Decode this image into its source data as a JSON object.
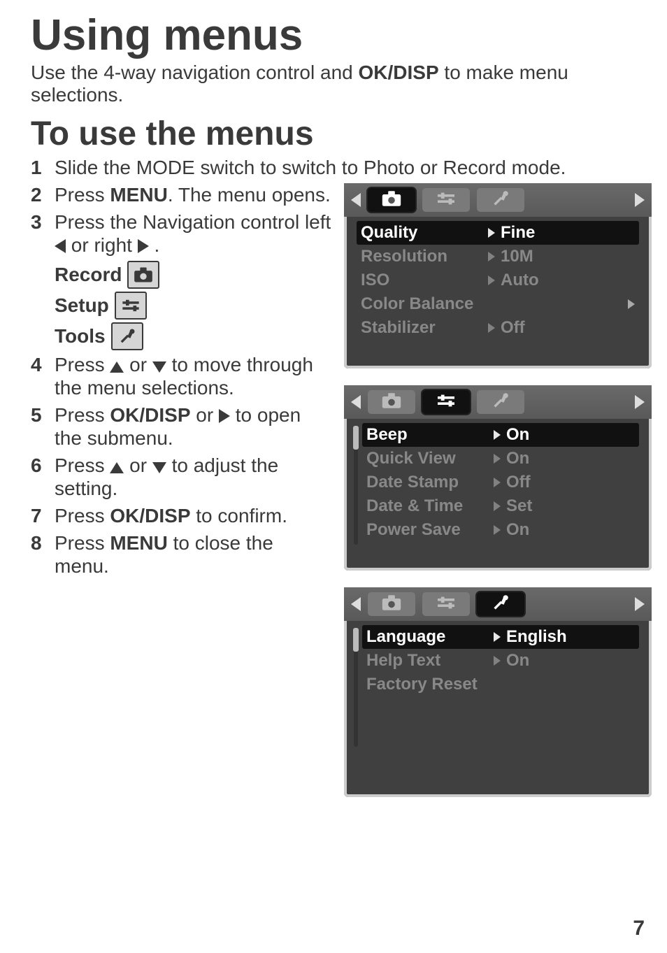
{
  "page_number": "7",
  "heading": "Using menus",
  "intro_pre": "Use the 4-way navigation control and ",
  "intro_bold": "OK/DISP",
  "intro_post": " to make menu selections.",
  "subheading": "To use the menus",
  "steps": [
    {
      "n": "1",
      "text_pre": "Slide the MODE switch to switch to Photo or Record mode.",
      "bold": "",
      "text_post": ""
    },
    {
      "n": "2",
      "text_pre": "Press ",
      "bold": "MENU",
      "text_post": ". The menu opens."
    },
    {
      "n": "3",
      "text_pre": "Press the Navigation control left ",
      "bold": "",
      "text_post": " or right "
    },
    {
      "n": "4",
      "text_pre": "Press ",
      "bold": "",
      "text_post": " to move through the menu selections."
    },
    {
      "n": "5",
      "text_pre": "Press ",
      "bold": "OK/DISP",
      "text_post": " or ",
      "tail": " to open the submenu."
    },
    {
      "n": "6",
      "text_pre": "Press ",
      "bold": "",
      "text_post": " to adjust the setting."
    },
    {
      "n": "7",
      "text_pre": "Press ",
      "bold": "OK/DISP",
      "text_post": " to confirm."
    },
    {
      "n": "8",
      "text_pre": "Press ",
      "bold": "MENU",
      "text_post": " to close the menu."
    }
  ],
  "icon_labels": {
    "record": "Record",
    "setup": "Setup",
    "tools": "Tools"
  },
  "step4_middle": " or ",
  "step6_middle": " or ",
  "screens": [
    {
      "active_tab": 0,
      "scrollbar": false,
      "rows": [
        {
          "label": "Quality",
          "value": "Fine",
          "selected": true
        },
        {
          "label": "Resolution",
          "value": "10M",
          "selected": false
        },
        {
          "label": "ISO",
          "value": "Auto",
          "selected": false
        },
        {
          "label": "Color Balance",
          "value": "",
          "selected": false,
          "right_caret": true
        },
        {
          "label": "Stabilizer",
          "value": "Off",
          "selected": false
        }
      ]
    },
    {
      "active_tab": 1,
      "scrollbar": true,
      "rows": [
        {
          "label": "Beep",
          "value": "On",
          "selected": true
        },
        {
          "label": "Quick View",
          "value": "On",
          "selected": false
        },
        {
          "label": "Date Stamp",
          "value": "Off",
          "selected": false
        },
        {
          "label": "Date & Time",
          "value": "Set",
          "selected": false
        },
        {
          "label": "Power Save",
          "value": "On",
          "selected": false
        }
      ]
    },
    {
      "active_tab": 2,
      "scrollbar": true,
      "rows": [
        {
          "label": "Language",
          "value": "English",
          "selected": true
        },
        {
          "label": "Help Text",
          "value": "On",
          "selected": false
        },
        {
          "label": "Factory Reset",
          "value": "",
          "selected": false
        }
      ]
    }
  ]
}
